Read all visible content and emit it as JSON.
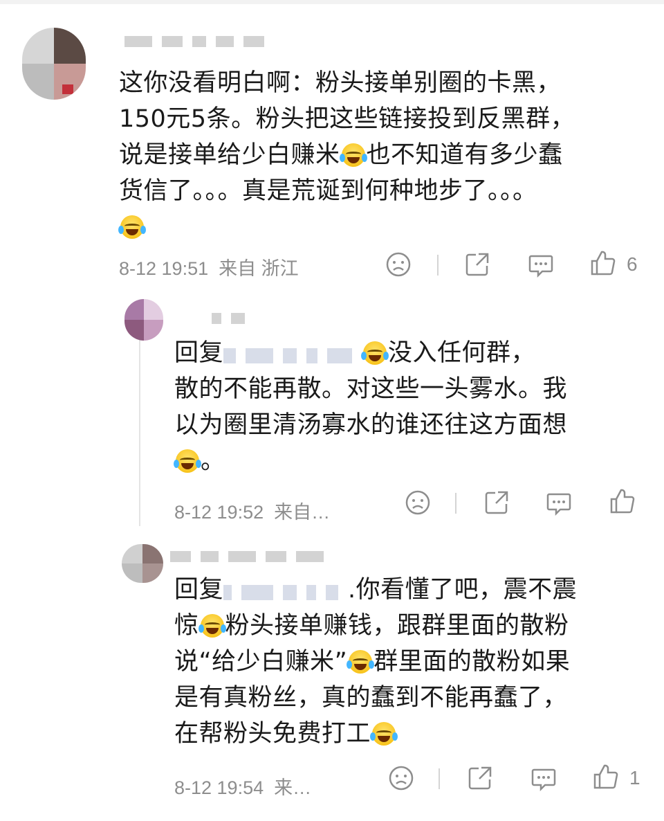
{
  "comments": [
    {
      "lines": [
        "这你没看明白啊：粉头接单别圈的卡黑，",
        "150元5条。粉头把这些链接投到反黑群，",
        "说是接单给少白赚米",
        "也不知道有多少蠢",
        "货信了。。。真是荒诞到何种地步了。。。"
      ],
      "time": "8-12 19:51",
      "location": "来自 浙江",
      "likes": "6"
    },
    {
      "reply_prefix": "回复",
      "reply_after_name": "没入任何群，",
      "lines": [
        "散的不能再散。对这些一头雾水。我",
        "以为圈里清汤寡水的谁还往这方面想",
        "。"
      ],
      "time": "8-12 19:52",
      "location": "来自…"
    },
    {
      "reply_prefix": "回复",
      "reply_after_name": ".你看懂了吧，震不震",
      "lines": [
        "惊",
        "粉头接单赚钱，跟群里面的散粉",
        "说“给少白赚米”",
        "群里面的散粉如果",
        "是有真粉丝，真的蠢到不能再蠢了，",
        "在帮粉头免费打工"
      ],
      "time": "8-12 19:54",
      "location": "来…",
      "likes": "1"
    }
  ],
  "icons": [
    "sad-face-icon",
    "share-icon",
    "comment-icon",
    "thumbs-up-icon",
    "crying-laughing-emoji"
  ]
}
